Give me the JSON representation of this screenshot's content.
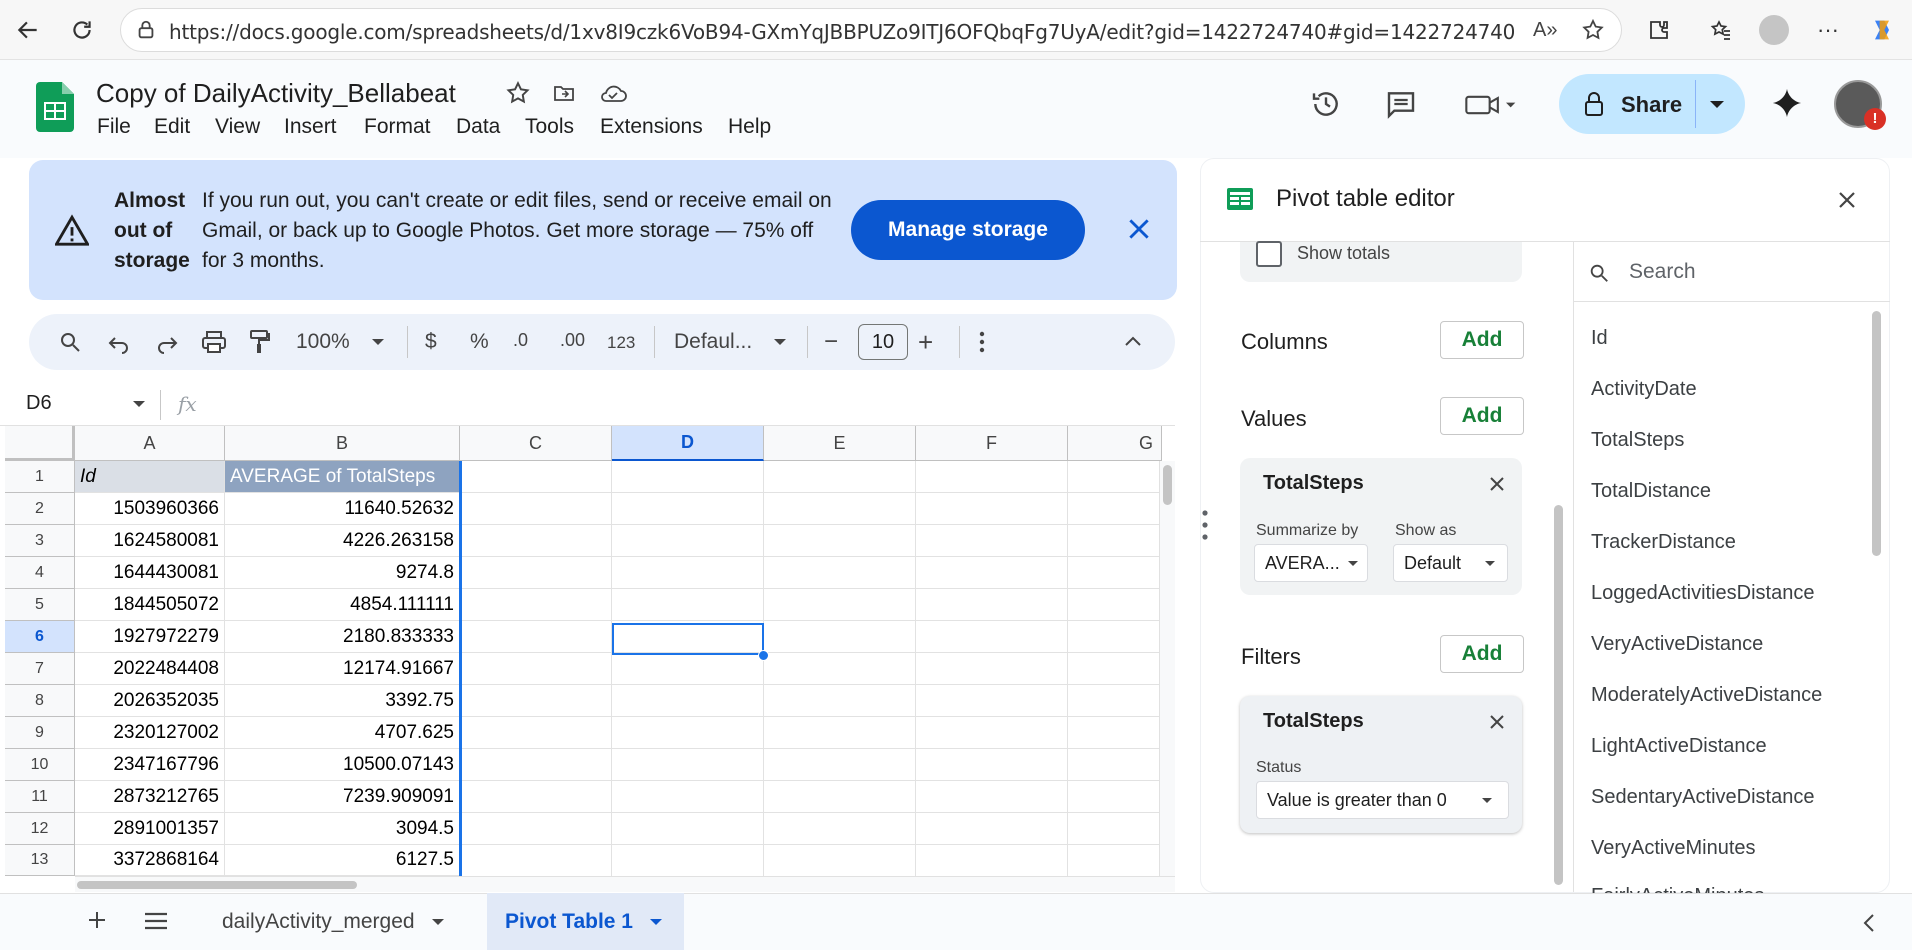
{
  "browser": {
    "url": "https://docs.google.com/spreadsheets/d/1xv8I9czk6VoB94-GXmYqJBBPUZo9ITJ6OFQbqFg7UyA/edit?gid=1422724740#gid=1422724740"
  },
  "app": {
    "title": "Copy of DailyActivity_Bellabeat",
    "menu": [
      "File",
      "Edit",
      "View",
      "Insert",
      "Format",
      "Data",
      "Tools",
      "Extensions",
      "Help"
    ],
    "share_label": "Share",
    "brand_color": "#0f9d58"
  },
  "banner": {
    "title": "Almost out of storage",
    "message": "If you run out, you can't create or edit files, send or receive email on Gmail, or back up to Google Photos. Get more storage — 75% off for 3 months.",
    "button": "Manage storage"
  },
  "toolbar": {
    "zoom": "100%",
    "currency": "$",
    "percent": "%",
    "dec_decrease": ".0",
    "dec_increase": ".00",
    "format_123": "123",
    "font": "Defaul...",
    "font_size": "10",
    "minus": "−",
    "plus": "+"
  },
  "formula": {
    "cell_ref": "D6",
    "fx": "fx"
  },
  "grid": {
    "columns": [
      "A",
      "B",
      "C",
      "D",
      "E",
      "F",
      "G"
    ],
    "selected_column": "D",
    "rows": [
      "1",
      "2",
      "3",
      "4",
      "5",
      "6",
      "7",
      "8",
      "9",
      "10",
      "11",
      "12",
      "13"
    ],
    "selected_row": "6",
    "header": {
      "a": "Id",
      "b": "AVERAGE of TotalSteps"
    },
    "data": [
      {
        "a": "1503960366",
        "b": "11640.52632"
      },
      {
        "a": "1624580081",
        "b": "4226.263158"
      },
      {
        "a": "1644430081",
        "b": "9274.8"
      },
      {
        "a": "1844505072",
        "b": "4854.111111"
      },
      {
        "a": "1927972279",
        "b": "2180.833333"
      },
      {
        "a": "2022484408",
        "b": "12174.91667"
      },
      {
        "a": "2026352035",
        "b": "3392.75"
      },
      {
        "a": "2320127002",
        "b": "4707.625"
      },
      {
        "a": "2347167796",
        "b": "10500.07143"
      },
      {
        "a": "2873212765",
        "b": "7239.909091"
      },
      {
        "a": "2891001357",
        "b": "3094.5"
      },
      {
        "a": "3372868164",
        "b": "6127.5"
      }
    ]
  },
  "sheets": {
    "tabs": [
      "dailyActivity_merged",
      "Pivot Table 1"
    ],
    "active": "Pivot Table 1"
  },
  "pivot": {
    "title": "Pivot table editor",
    "show_totals": "Show totals",
    "columns_label": "Columns",
    "values_label": "Values",
    "filters_label": "Filters",
    "add_label": "Add",
    "value_card": {
      "field": "TotalSteps",
      "summarize_label": "Summarize by",
      "summarize_value": "AVERA...",
      "show_as_label": "Show as",
      "show_as_value": "Default"
    },
    "filter_card": {
      "field": "TotalSteps",
      "status_label": "Status",
      "status_value": "Value is greater than 0"
    },
    "search_placeholder": "Search",
    "fields": [
      "Id",
      "ActivityDate",
      "TotalSteps",
      "TotalDistance",
      "TrackerDistance",
      "LoggedActivitiesDistance",
      "VeryActiveDistance",
      "ModeratelyActiveDistance",
      "LightActiveDistance",
      "SedentaryActiveDistance",
      "VeryActiveMinutes",
      "FairlyActiveMinutes"
    ]
  }
}
